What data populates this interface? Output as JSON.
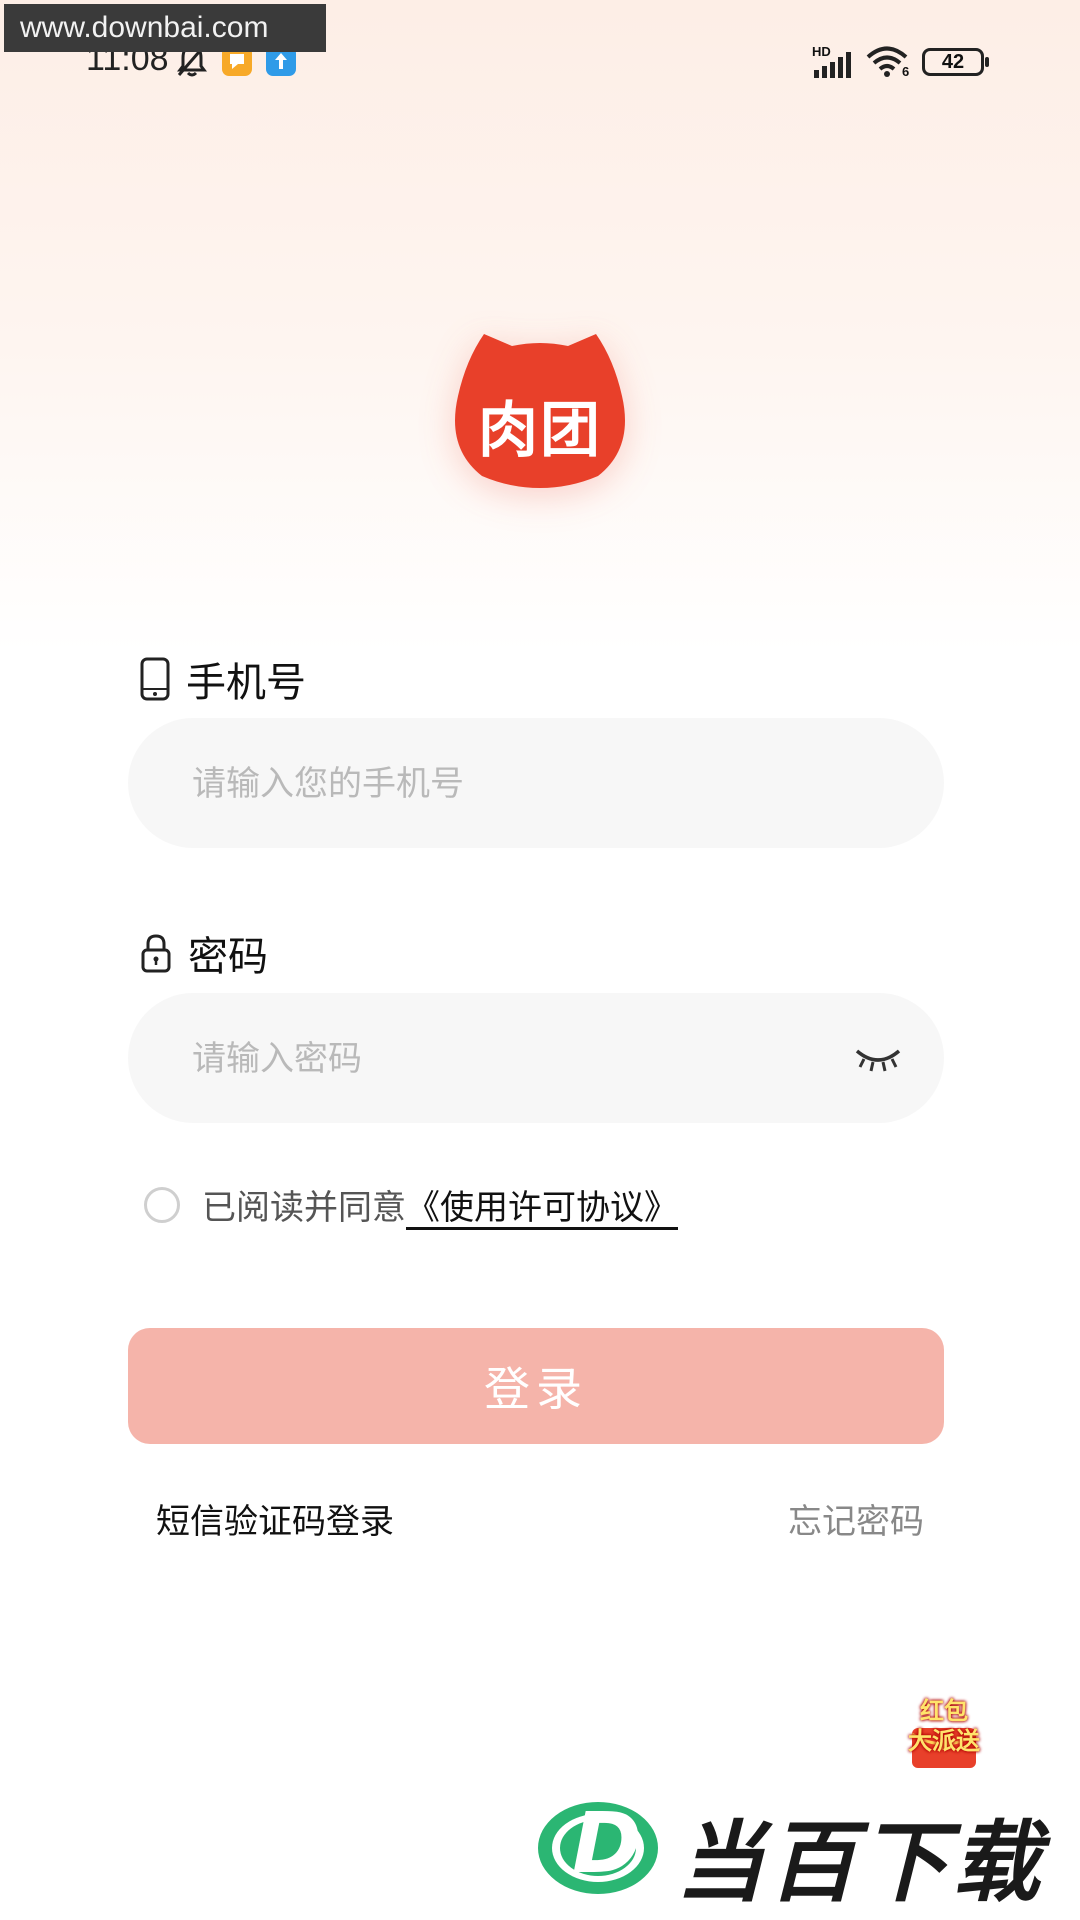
{
  "watermark_top": "www.downbai.com",
  "status_bar": {
    "time": "11:08",
    "battery": "42",
    "icons": [
      "bell-off-icon",
      "notification-app-icon",
      "upload-app-icon",
      "signal-icon",
      "wifi-icon",
      "battery-icon"
    ],
    "network_label": "HD",
    "wifi_label": "6"
  },
  "logo": {
    "text": "肉团",
    "color": "#e8402a"
  },
  "phone": {
    "label": "手机号",
    "placeholder": "请输入您的手机号",
    "value": ""
  },
  "password": {
    "label": "密码",
    "placeholder": "请输入密码",
    "value": ""
  },
  "agreement": {
    "checked": false,
    "text": "已阅读并同意",
    "link": "《使用许可协议》"
  },
  "login_button": {
    "label": "登录",
    "color": "#f5b4aa"
  },
  "sms_login": "短信验证码登录",
  "forgot_password": "忘记密码",
  "promo_badge": {
    "line1": "红包",
    "line2": "大派送"
  },
  "brand_watermark": {
    "letter": "D",
    "text": "当百下载",
    "accent": "#2bb673"
  }
}
